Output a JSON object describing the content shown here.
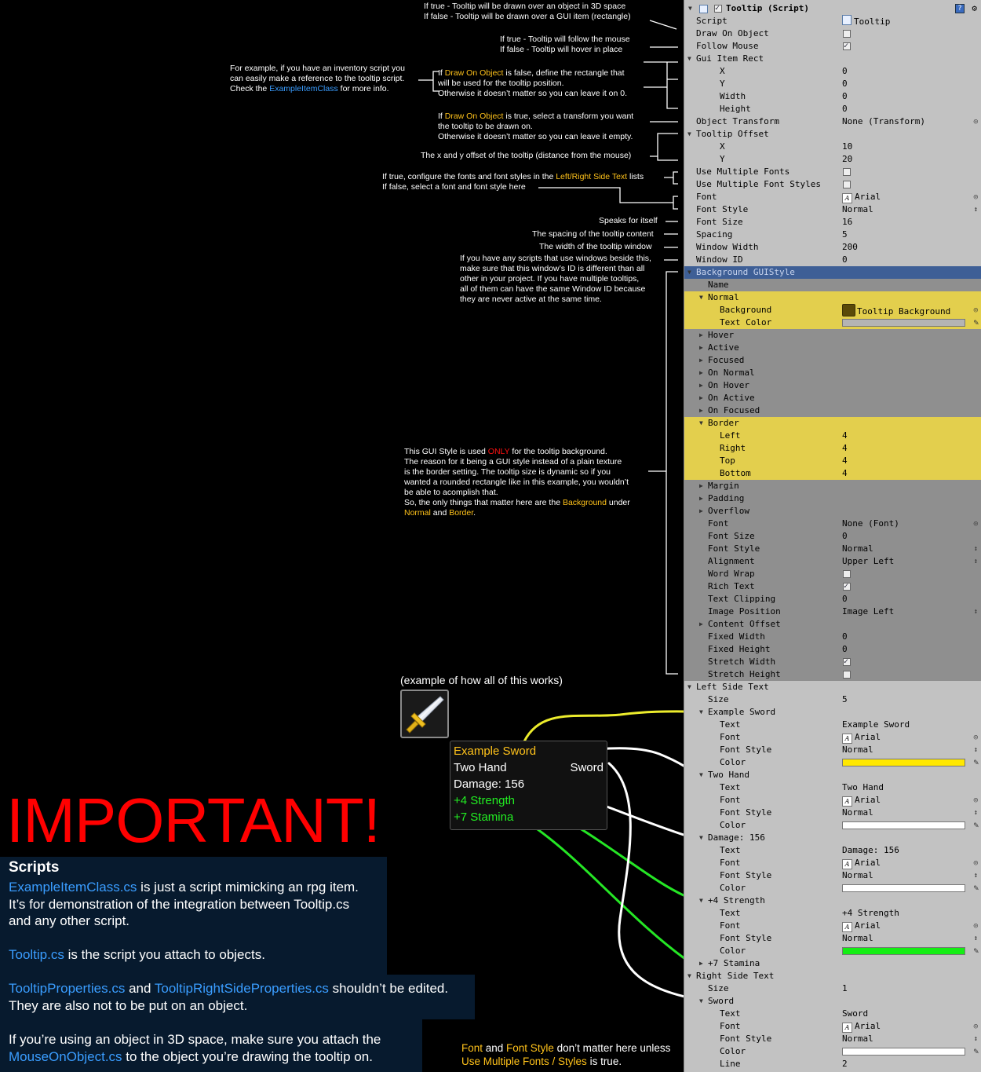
{
  "notes": {
    "draw_on_object_true": "If true - Tooltip will be drawn over an object in 3D space",
    "draw_on_object_false": "If false - Tooltip will be drawn over a GUI item (rectangle)",
    "follow_mouse_true": "If true - Tooltip will follow the mouse",
    "follow_mouse_false": "If false - Tooltip will hover in place",
    "inventory_1": "For example, if you have an inventory script you",
    "inventory_2": "can easily make a reference to the tooltip script.",
    "inventory_3a": "Check the ",
    "inventory_3b": "ExampleItemClass",
    "inventory_3c": " for more info.",
    "rect_1a": "If ",
    "rect_1b": "Draw On Object",
    "rect_1c": " is false, define the rectangle that",
    "rect_2": "will be used for the tooltip position.",
    "rect_3": "Otherwise it doesn’t matter so you can leave it on 0.",
    "transform_1a": "If ",
    "transform_1b": "Draw On Object",
    "transform_1c": " is true, select a transform you want",
    "transform_2": "the tooltip to be drawn on.",
    "transform_3": "Otherwise it doesn’t matter so you can leave it empty.",
    "offset": "The x and y offset of the tooltip (distance from the mouse)",
    "fonts_1a": "If true, configure the fonts and font styles in the ",
    "fonts_1b": "Left/Right Side Text",
    "fonts_1c": " lists",
    "fonts_2": "If false, select a font and font style here",
    "speaks": "Speaks for itself",
    "spacing": "The spacing of the tooltip content",
    "width": "The width of the tooltip window",
    "winid_1": "If you have any scripts that use windows beside this,",
    "winid_2": "make sure that this window’s ID is different than all",
    "winid_3": "other in your project. If you have multiple tooltips,",
    "winid_4": "all of them can have the same Window ID because",
    "winid_5": "they are never active at the same time.",
    "gui_1a": "This GUI Style is used ",
    "gui_1b": "ONLY",
    "gui_1c": " for the tooltip background.",
    "gui_2": "The reason for it being a GUI style instead of a plain texture",
    "gui_3": "is the border setting. The tooltip size is dynamic so if you",
    "gui_4": "wanted a rounded rectangle like in this example, you wouldn’t",
    "gui_5": "be able to acomplish that.",
    "gui_6a": "So, the only things that matter here are the ",
    "gui_6b": "Background",
    "gui_6c": " under",
    "gui_7a": "Normal",
    "gui_7b": " and ",
    "gui_7c": "Border",
    "gui_7d": ".",
    "example_caption": "(example of how all of this works)",
    "bottom_1a": "Font",
    "bottom_1b": " and ",
    "bottom_1c": "Font Style",
    "bottom_1d": " don’t matter here unless",
    "bottom_2a": "Use Multiple Fonts / Styles",
    "bottom_2b": " is true."
  },
  "tooltip_demo": {
    "title": "Example Sword",
    "left2": "Two Hand",
    "right2": "Sword",
    "damage": "Damage: 156",
    "strength": "+4 Strength",
    "stamina": "+7 Stamina"
  },
  "important": "IMPORTANT!",
  "scripts": {
    "heading": "Scripts",
    "p1_link": "ExampleItemClass.cs",
    "p1_rest": " is just a script mimicking an rpg item.",
    "p1_line2": "It’s for demonstration of the integration between Tooltip.cs",
    "p1_line3": "and any other script.",
    "p2_link": "Tooltip.cs",
    "p2_rest": " is the script you attach to objects.",
    "p3_link1": "TooltipProperties.cs",
    "p3_mid": " and ",
    "p3_link2": "TooltipRightSideProperties.cs",
    "p3_rest": " shouldn’t be edited.",
    "p3_line2": "They are also not to be put on an object.",
    "p4_line1": "If you’re using an object in 3D space, make sure you attach the",
    "p4_link": "MouseOnObject.cs",
    "p4_rest": " to the object you’re drawing the tooltip on."
  },
  "inspector": {
    "header_title": "Tooltip (Script)",
    "rows": [
      {
        "l": "Script",
        "v": "Tooltip",
        "icon": "script"
      },
      {
        "l": "Draw On Object",
        "cb": false
      },
      {
        "l": "Follow Mouse",
        "cb": true
      },
      {
        "l": "Gui Item Rect",
        "fold": "open"
      },
      {
        "l": "X",
        "v": "0",
        "ind": 2
      },
      {
        "l": "Y",
        "v": "0",
        "ind": 2
      },
      {
        "l": "Width",
        "v": "0",
        "ind": 2
      },
      {
        "l": "Height",
        "v": "0",
        "ind": 2
      },
      {
        "l": "Object Transform",
        "v": "None (Transform)",
        "dot": true
      },
      {
        "l": "Tooltip Offset",
        "fold": "open"
      },
      {
        "l": "X",
        "v": "10",
        "ind": 2
      },
      {
        "l": "Y",
        "v": "20",
        "ind": 2
      },
      {
        "l": "Use Multiple Fonts",
        "cb": false
      },
      {
        "l": "Use Multiple Font Styles",
        "cb": false
      },
      {
        "l": "Font",
        "v": "Arial",
        "icon": "font",
        "dot": true
      },
      {
        "l": "Font Style",
        "v": "Normal",
        "updn": true
      },
      {
        "l": "Font Size",
        "v": "16"
      },
      {
        "l": "Spacing",
        "v": "5"
      },
      {
        "l": "Window Width",
        "v": "200"
      },
      {
        "l": "Window ID",
        "v": "0"
      },
      {
        "l": "Background GUIStyle",
        "fold": "open",
        "bg": "sel"
      },
      {
        "l": "Name",
        "ind": 1,
        "bg": "dark"
      },
      {
        "l": "Normal",
        "fold": "open",
        "ind": 1,
        "bg": "yellow"
      },
      {
        "l": "Background",
        "v": "Tooltip Background",
        "icon": "tex",
        "ind": 2,
        "dot": true,
        "bg": "yellow"
      },
      {
        "l": "Text Color",
        "ind": 2,
        "bg": "yellow",
        "swatch": "#b4b4b4"
      },
      {
        "l": "Hover",
        "fold": "closed",
        "ind": 1,
        "bg": "dark"
      },
      {
        "l": "Active",
        "fold": "closed",
        "ind": 1,
        "bg": "dark"
      },
      {
        "l": "Focused",
        "fold": "closed",
        "ind": 1,
        "bg": "dark"
      },
      {
        "l": "On Normal",
        "fold": "closed",
        "ind": 1,
        "bg": "dark"
      },
      {
        "l": "On Hover",
        "fold": "closed",
        "ind": 1,
        "bg": "dark"
      },
      {
        "l": "On Active",
        "fold": "closed",
        "ind": 1,
        "bg": "dark"
      },
      {
        "l": "On Focused",
        "fold": "closed",
        "ind": 1,
        "bg": "dark"
      },
      {
        "l": "Border",
        "fold": "open",
        "ind": 1,
        "bg": "yellow"
      },
      {
        "l": "Left",
        "v": "4",
        "ind": 2,
        "bg": "yellow"
      },
      {
        "l": "Right",
        "v": "4",
        "ind": 2,
        "bg": "yellow"
      },
      {
        "l": "Top",
        "v": "4",
        "ind": 2,
        "bg": "yellow"
      },
      {
        "l": "Bottom",
        "v": "4",
        "ind": 2,
        "bg": "yellow"
      },
      {
        "l": "Margin",
        "fold": "closed",
        "ind": 1,
        "bg": "dark"
      },
      {
        "l": "Padding",
        "fold": "closed",
        "ind": 1,
        "bg": "dark"
      },
      {
        "l": "Overflow",
        "fold": "closed",
        "ind": 1,
        "bg": "dark"
      },
      {
        "l": "Font",
        "v": "None (Font)",
        "ind": 1,
        "bg": "dark",
        "dot": true
      },
      {
        "l": "Font Size",
        "v": "0",
        "ind": 1,
        "bg": "dark"
      },
      {
        "l": "Font Style",
        "v": "Normal",
        "ind": 1,
        "bg": "dark",
        "updn": true
      },
      {
        "l": "Alignment",
        "v": "Upper Left",
        "ind": 1,
        "bg": "dark",
        "updn": true
      },
      {
        "l": "Word Wrap",
        "cb": false,
        "ind": 1,
        "bg": "dark"
      },
      {
        "l": "Rich Text",
        "cb": true,
        "ind": 1,
        "bg": "dark"
      },
      {
        "l": "Text Clipping",
        "v": "0",
        "ind": 1,
        "bg": "dark"
      },
      {
        "l": "Image Position",
        "v": "Image Left",
        "ind": 1,
        "bg": "dark",
        "updn": true
      },
      {
        "l": "Content Offset",
        "fold": "closed",
        "ind": 1,
        "bg": "dark"
      },
      {
        "l": "Fixed Width",
        "v": "0",
        "ind": 1,
        "bg": "dark"
      },
      {
        "l": "Fixed Height",
        "v": "0",
        "ind": 1,
        "bg": "dark"
      },
      {
        "l": "Stretch Width",
        "cb": true,
        "ind": 1,
        "bg": "dark"
      },
      {
        "l": "Stretch Height",
        "cb": false,
        "ind": 1,
        "bg": "dark"
      },
      {
        "l": "Left Side Text",
        "fold": "open"
      },
      {
        "l": "Size",
        "v": "5",
        "ind": 1
      },
      {
        "l": "Example Sword",
        "fold": "open",
        "ind": 1
      },
      {
        "l": "Text",
        "v": "Example Sword",
        "ind": 2
      },
      {
        "l": "Font",
        "v": "Arial",
        "icon": "font",
        "ind": 2,
        "dot": true
      },
      {
        "l": "Font Style",
        "v": "Normal",
        "ind": 2,
        "updn": true
      },
      {
        "l": "Color",
        "ind": 2,
        "swatch": "#ffe800"
      },
      {
        "l": "Two Hand",
        "fold": "open",
        "ind": 1
      },
      {
        "l": "Text",
        "v": "Two Hand",
        "ind": 2
      },
      {
        "l": "Font",
        "v": "Arial",
        "icon": "font",
        "ind": 2,
        "dot": true
      },
      {
        "l": "Font Style",
        "v": "Normal",
        "ind": 2,
        "updn": true
      },
      {
        "l": "Color",
        "ind": 2,
        "swatch": "#ffffff"
      },
      {
        "l": "Damage: 156",
        "fold": "open",
        "ind": 1
      },
      {
        "l": "Text",
        "v": "Damage: 156",
        "ind": 2
      },
      {
        "l": "Font",
        "v": "Arial",
        "icon": "font",
        "ind": 2,
        "dot": true
      },
      {
        "l": "Font Style",
        "v": "Normal",
        "ind": 2,
        "updn": true
      },
      {
        "l": "Color",
        "ind": 2,
        "swatch": "#ffffff"
      },
      {
        "l": "+4 Strength",
        "fold": "open",
        "ind": 1
      },
      {
        "l": "Text",
        "v": "+4 Strength",
        "ind": 2
      },
      {
        "l": "Font",
        "v": "Arial",
        "icon": "font",
        "ind": 2,
        "dot": true
      },
      {
        "l": "Font Style",
        "v": "Normal",
        "ind": 2,
        "updn": true
      },
      {
        "l": "Color",
        "ind": 2,
        "swatch": "#14ee14"
      },
      {
        "l": "+7 Stamina",
        "fold": "closed",
        "ind": 1
      },
      {
        "l": "Right Side Text",
        "fold": "open"
      },
      {
        "l": "Size",
        "v": "1",
        "ind": 1
      },
      {
        "l": "Sword",
        "fold": "open",
        "ind": 1
      },
      {
        "l": "Text",
        "v": "Sword",
        "ind": 2
      },
      {
        "l": "Font",
        "v": "Arial",
        "icon": "font",
        "ind": 2,
        "dot": true
      },
      {
        "l": "Font Style",
        "v": "Normal",
        "ind": 2,
        "updn": true
      },
      {
        "l": "Color",
        "ind": 2,
        "swatch": "#ffffff"
      },
      {
        "l": "Line",
        "v": "2",
        "ind": 2
      }
    ]
  },
  "colors": {
    "highlight": "#ffc21a",
    "link": "#3a9dff",
    "important": "#ff0000",
    "strength": "#22ee22",
    "title": "#ffc21a"
  }
}
